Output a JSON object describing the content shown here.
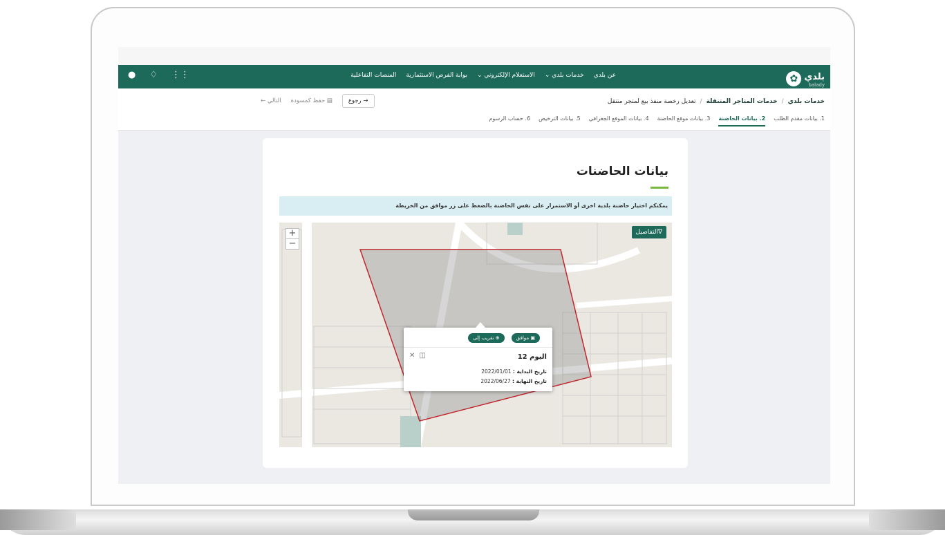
{
  "brand": {
    "name": "بلدي",
    "sub": "balady"
  },
  "nav": {
    "links": [
      "عن بلدي",
      "خدمات بلدي",
      "الاستعلام الإلكتروني",
      "بوابة الفرص الاستثمارية",
      "المنصات التفاعلية"
    ],
    "icons": [
      "grid-icon",
      "bell-icon",
      "user-icon"
    ]
  },
  "breadcrumb": {
    "home": "خدمات بلدي",
    "section": "خدمات المتاجر المتنقلة",
    "current": "تعديل رخصة منفذ بيع لمتجر متنقل"
  },
  "actions": {
    "back": "رجوع",
    "save": "حفظ كمسودة",
    "next": "التالي"
  },
  "steps": [
    {
      "label": "1. بيانات مقدم الطلب",
      "active": false
    },
    {
      "label": "2. بيانات الحاضنة",
      "active": true
    },
    {
      "label": "3. بيانات موقع الحاضنة",
      "active": false
    },
    {
      "label": "4. بيانات الموقع الجغرافي",
      "active": false
    },
    {
      "label": "5. بيانات الترخيص",
      "active": false
    },
    {
      "label": "6. حساب الرسوم",
      "active": false
    }
  ],
  "page": {
    "title": "بيانات الحاضنات",
    "notice": "يمكنكم اختيار حاضنة بلدية اخرى أو الاستمرار على نفس الحاضنة بالضغط على زر موافق من الخريطة"
  },
  "map": {
    "details_button": "التفاصيل",
    "zoom_in": "+",
    "zoom_out": "−",
    "popup": {
      "approve": "موافق",
      "zoom_to": "تقريب إلى",
      "title": "اليوم 12",
      "start_label": "تاريخ البداية :",
      "start_value": "2022/01/01",
      "end_label": "تاريخ النهاية :",
      "end_value": "2022/06/27"
    }
  },
  "colors": {
    "primary": "#1d6a5b",
    "accent": "#79b83c",
    "polygon": "#c0272d"
  }
}
